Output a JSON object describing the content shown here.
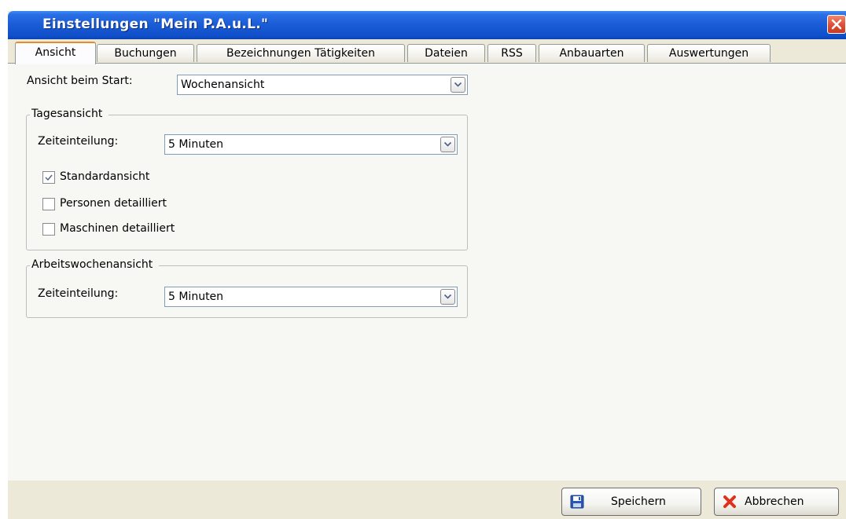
{
  "window": {
    "title": "Einstellungen \"Mein P.A.u.L.\""
  },
  "tabs": [
    {
      "label": "Ansicht",
      "active": true
    },
    {
      "label": "Buchungen",
      "active": false
    },
    {
      "label": "Bezeichnungen Tätigkeiten",
      "active": false
    },
    {
      "label": "Dateien",
      "active": false
    },
    {
      "label": "RSS",
      "active": false
    },
    {
      "label": "Anbauarten",
      "active": false
    },
    {
      "label": "Auswertungen",
      "active": false
    }
  ],
  "ansicht": {
    "start_label": "Ansicht beim Start:",
    "start_value": "Wochenansicht"
  },
  "tagesansicht": {
    "title": "Tagesansicht",
    "zeit_label": "Zeiteinteilung:",
    "zeit_value": "5 Minuten",
    "checkboxes": [
      {
        "label": "Standardansicht",
        "checked": true
      },
      {
        "label": "Personen detailliert",
        "checked": false
      },
      {
        "label": "Maschinen detailliert",
        "checked": false
      }
    ]
  },
  "arbeitswochenansicht": {
    "title": "Arbeitswochenansicht",
    "zeit_label": "Zeiteinteilung:",
    "zeit_value": "5 Minuten"
  },
  "buttons": {
    "save_label": "Speichern",
    "cancel_label": "Abbrechen"
  },
  "icons": {
    "close": "close-icon",
    "dropdown": "chevron-down-icon",
    "check": "check-icon",
    "save": "floppy-disk-icon",
    "cancel": "red-x-icon"
  },
  "colors": {
    "titlebar": "#1a5bd6",
    "active_tab_accent": "#e68b2c",
    "dialog_bg": "#ece9d8",
    "panel_bg": "#f7f7f3",
    "cancel_icon": "#e0301e",
    "save_icon": "#2a56b8"
  }
}
